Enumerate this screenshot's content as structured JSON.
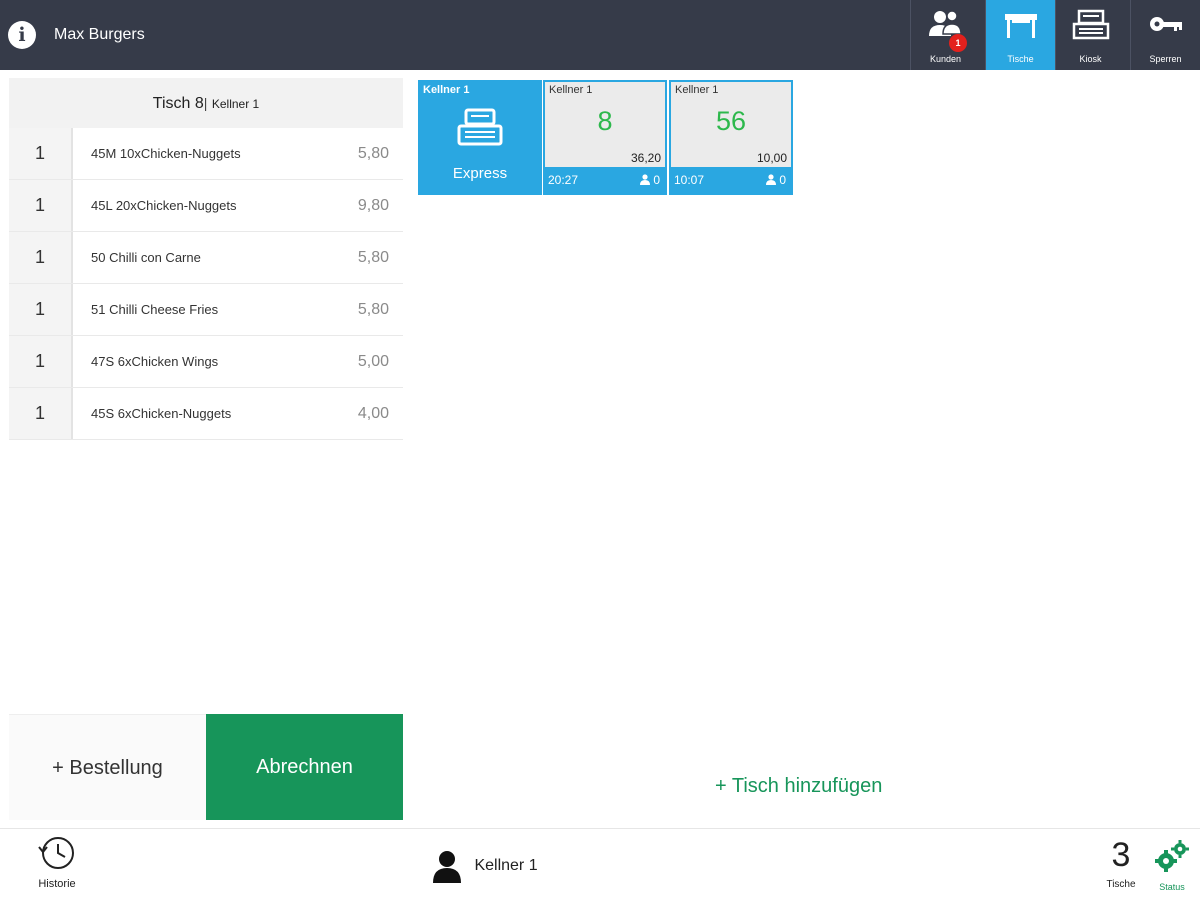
{
  "header": {
    "title": "Max Burgers",
    "nav": [
      {
        "label": "Kunden",
        "icon": "customers-icon",
        "badge": "1"
      },
      {
        "label": "Tische",
        "icon": "table-icon",
        "active": true
      },
      {
        "label": "Kiosk",
        "icon": "cash-register-icon"
      },
      {
        "label": "Sperren",
        "icon": "key-icon"
      }
    ]
  },
  "order": {
    "table": "Tisch 8",
    "separator": "|",
    "waiter": "Kellner 1",
    "items": [
      {
        "qty": "1",
        "name": "45M 10xChicken-Nuggets",
        "price": "5,80"
      },
      {
        "qty": "1",
        "name": "45L 20xChicken-Nuggets",
        "price": "9,80"
      },
      {
        "qty": "1",
        "name": "50 Chilli con Carne",
        "price": "5,80"
      },
      {
        "qty": "1",
        "name": "51 Chilli Cheese Fries",
        "price": "5,80"
      },
      {
        "qty": "1",
        "name": "47S 6xChicken Wings",
        "price": "5,00"
      },
      {
        "qty": "1",
        "name": "45S 6xChicken-Nuggets",
        "price": "4,00"
      }
    ],
    "add_order_label": "+ Bestellung",
    "checkout_label": "Abrechnen"
  },
  "tables": {
    "express": {
      "waiter": "Kellner 1",
      "label": "Express"
    },
    "list": [
      {
        "waiter": "Kellner 1",
        "number": "8",
        "amount": "36,20",
        "time": "20:27",
        "guests": "0"
      },
      {
        "waiter": "Kellner 1",
        "number": "56",
        "amount": "10,00",
        "time": "10:07",
        "guests": "0"
      }
    ],
    "add_label": "+ Tisch hinzufügen"
  },
  "footer": {
    "history_label": "Historie",
    "user_name": "Kellner 1",
    "table_count": "3",
    "table_count_label": "Tische",
    "status_label": "Status"
  },
  "colors": {
    "topbar": "#363b49",
    "accent_blue": "#2aa7e1",
    "accent_green": "#17955a",
    "table_number_green": "#2db84c",
    "badge_red": "#e3211d"
  }
}
